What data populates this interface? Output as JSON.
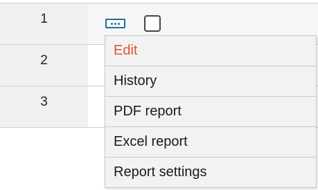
{
  "rows": [
    {
      "number": "1"
    },
    {
      "number": "2"
    },
    {
      "number": "3"
    }
  ],
  "context_menu": {
    "items": [
      {
        "label": "Edit",
        "highlighted": true
      },
      {
        "label": "History"
      },
      {
        "label": "PDF report"
      },
      {
        "label": "Excel report"
      },
      {
        "label": "Report settings"
      }
    ]
  },
  "colors": {
    "accent": "#1a6e96",
    "highlight_text": "#e0522e",
    "row_header_bg": "#f0f0f0",
    "menu_bg": "#f2f2f2"
  },
  "icons": {
    "more_button": "more-horizontal-icon",
    "checkbox": "checkbox-unchecked-icon"
  }
}
